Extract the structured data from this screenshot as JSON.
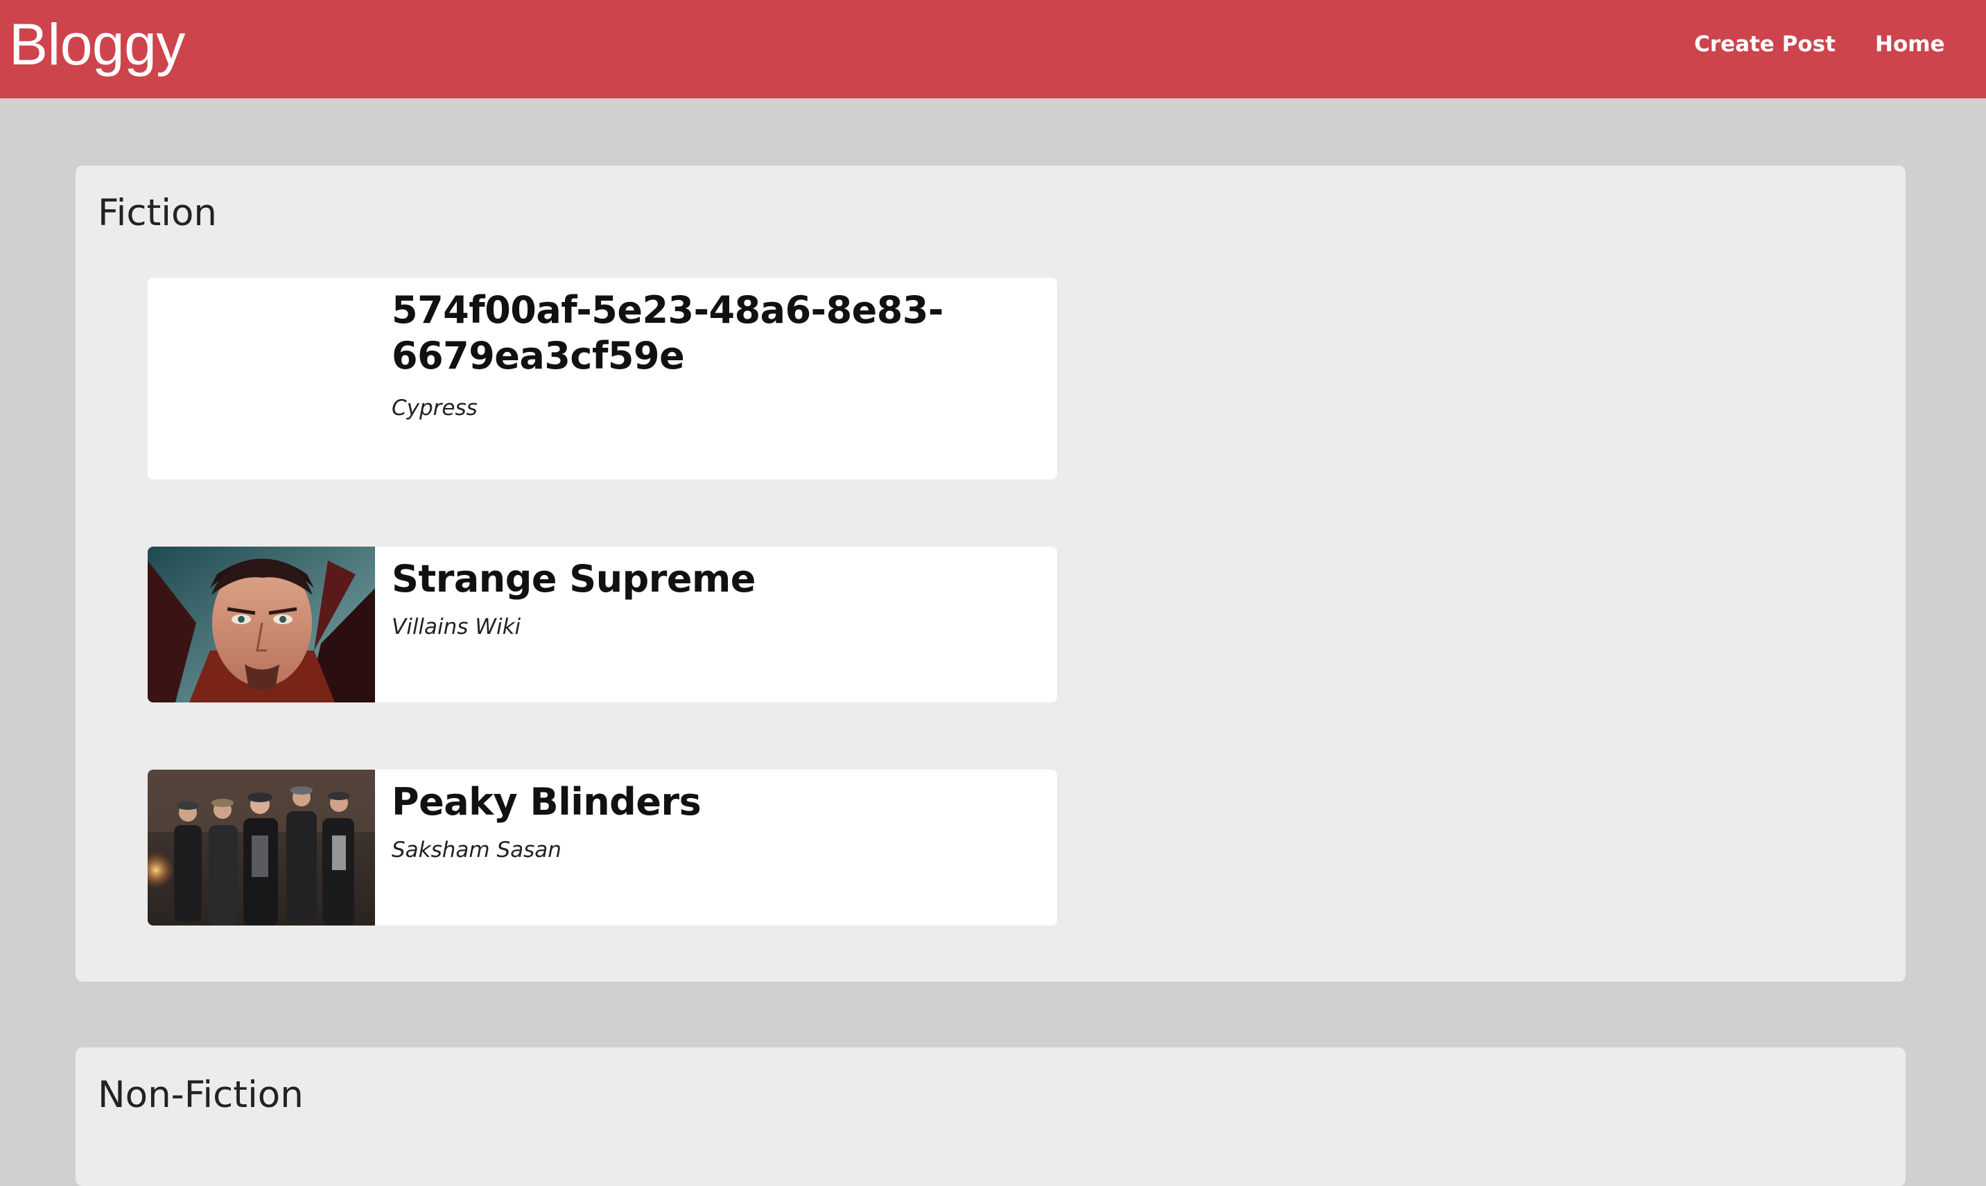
{
  "nav": {
    "brand": "Bloggy",
    "links": [
      {
        "label": "Create Post"
      },
      {
        "label": "Home"
      }
    ]
  },
  "sections": [
    {
      "title": "Fiction",
      "posts": [
        {
          "title": "574f00af-5e23-48a6-8e83-6679ea3cf59e",
          "author": "Cypress",
          "has_image": false
        },
        {
          "title": "Strange Supreme",
          "author": "Villains Wiki",
          "has_image": true,
          "image": "dark-caped-sorcerer-portrait"
        },
        {
          "title": "Peaky Blinders",
          "author": "Saksham Sasan",
          "has_image": true,
          "image": "group-in-flat-caps-walking"
        }
      ]
    },
    {
      "title": "Non-Fiction",
      "posts": []
    }
  ],
  "colors": {
    "navbar": "#cd444c",
    "page_background": "#d0d0d0",
    "section_background": "#ececec",
    "card_background": "#ffffff"
  }
}
